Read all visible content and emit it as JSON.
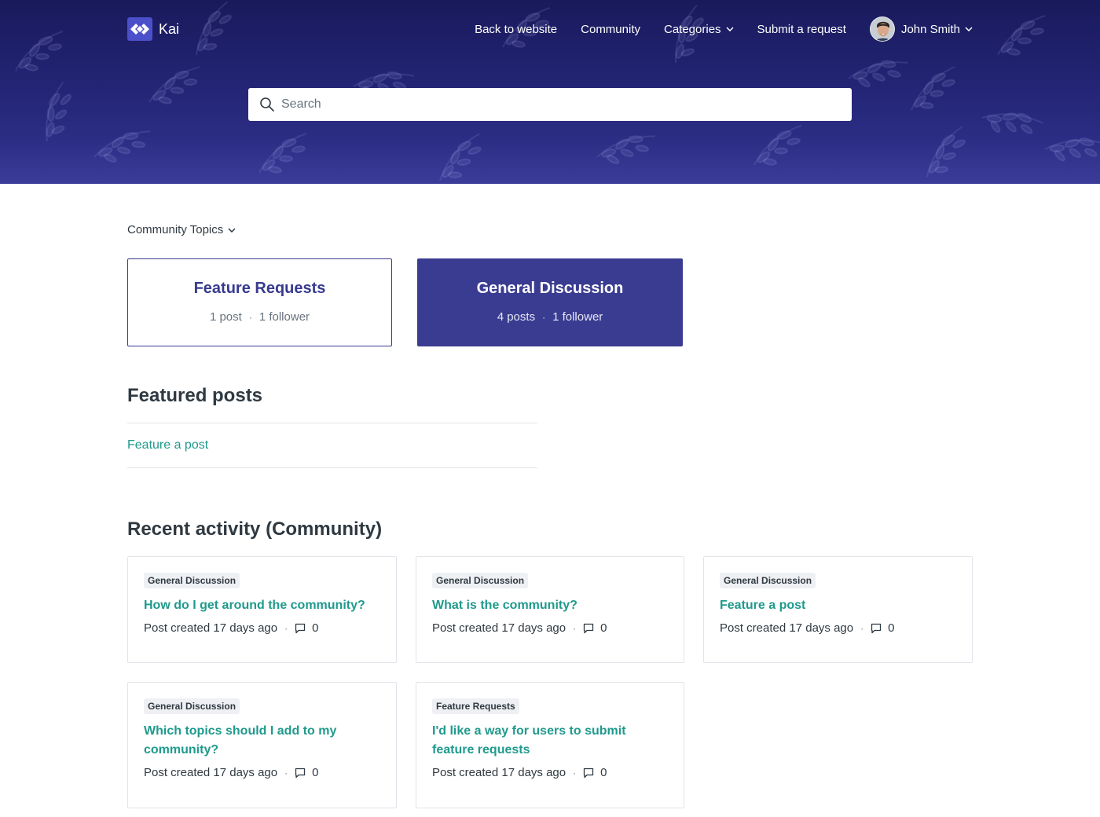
{
  "brand": {
    "name": "Kai",
    "accent": "#3a3c91",
    "link_color": "#1f9a8c"
  },
  "nav": {
    "back": "Back to website",
    "community": "Community",
    "categories": "Categories",
    "submit": "Submit a request",
    "user": "John Smith"
  },
  "search": {
    "placeholder": "Search"
  },
  "topics_dropdown": "Community Topics",
  "topics": [
    {
      "title": "Feature Requests",
      "posts": "1 post",
      "followers": "1 follower"
    },
    {
      "title": "General Discussion",
      "posts": "4 posts",
      "followers": "1 follower"
    }
  ],
  "featured": {
    "heading": "Featured posts",
    "link": "Feature a post"
  },
  "recent": {
    "heading": "Recent activity (Community)",
    "posts": [
      {
        "topic": "General Discussion",
        "title": "How do I get around the community?",
        "created": "Post created 17 days ago",
        "comments": "0"
      },
      {
        "topic": "General Discussion",
        "title": "What is the community?",
        "created": "Post created 17 days ago",
        "comments": "0"
      },
      {
        "topic": "General Discussion",
        "title": "Feature a post",
        "created": "Post created 17 days ago",
        "comments": "0"
      },
      {
        "topic": "General Discussion",
        "title": "Which topics should I add to my community?",
        "created": "Post created 17 days ago",
        "comments": "0"
      },
      {
        "topic": "Feature Requests",
        "title": "I'd like a way for users to submit feature requests",
        "created": "Post created 17 days ago",
        "comments": "0"
      }
    ]
  },
  "icons": {
    "logo": "diamond-arrows-icon",
    "search": "search-icon",
    "chevron": "chevron-down-icon",
    "comment": "comment-icon"
  }
}
